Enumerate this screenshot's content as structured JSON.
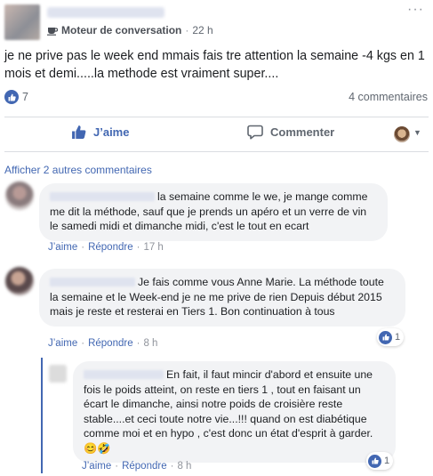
{
  "post": {
    "page_name": "Moteur de conversation",
    "time": "22 h",
    "text": "je ne prive pas le week end mmais fais tre attention la semaine -4 kgs en 1 mois et demi.....la methode est vraiment super....",
    "reactions_count": "7",
    "comments_count": "4 commentaires"
  },
  "actions": {
    "like_label": "J’aime",
    "comment_label": "Commenter"
  },
  "more_comments": "Afficher 2 autres commentaires",
  "comments": [
    {
      "text": "la semaine comme le we, je mange comme me dit la méthode, sauf que je prends un apéro et un verre de vin le samedi midi et dimanche midi, c'est le tout en ecart",
      "like": "J’aime",
      "reply": "Répondre",
      "time": "17 h"
    },
    {
      "text": "Je fais comme vous Anne Marie. La méthode toute la semaine et le Week-end je ne me prive de rien Depuis début 2015 mais je reste et resterai en Tiers 1. Bon continuation à tous",
      "like": "J’aime",
      "reply": "Répondre",
      "time": "8 h",
      "reactions": "1"
    },
    {
      "text": "En fait, il faut mincir d'abord et ensuite une fois le poids atteint, on reste en tiers 1 , tout en faisant un écart le dimanche, ainsi notre poids de croisière reste stable....et ceci toute notre vie...!!! quand on est diabétique comme moi et en hypo , c'est donc un état d'esprit à garder.😊🤣",
      "like": "J’aime",
      "reply": "Répondre",
      "time": "8 h",
      "reactions": "1"
    }
  ],
  "colors": {
    "accent": "#4267b2",
    "bubble": "#f2f3f5",
    "muted": "#606770"
  }
}
